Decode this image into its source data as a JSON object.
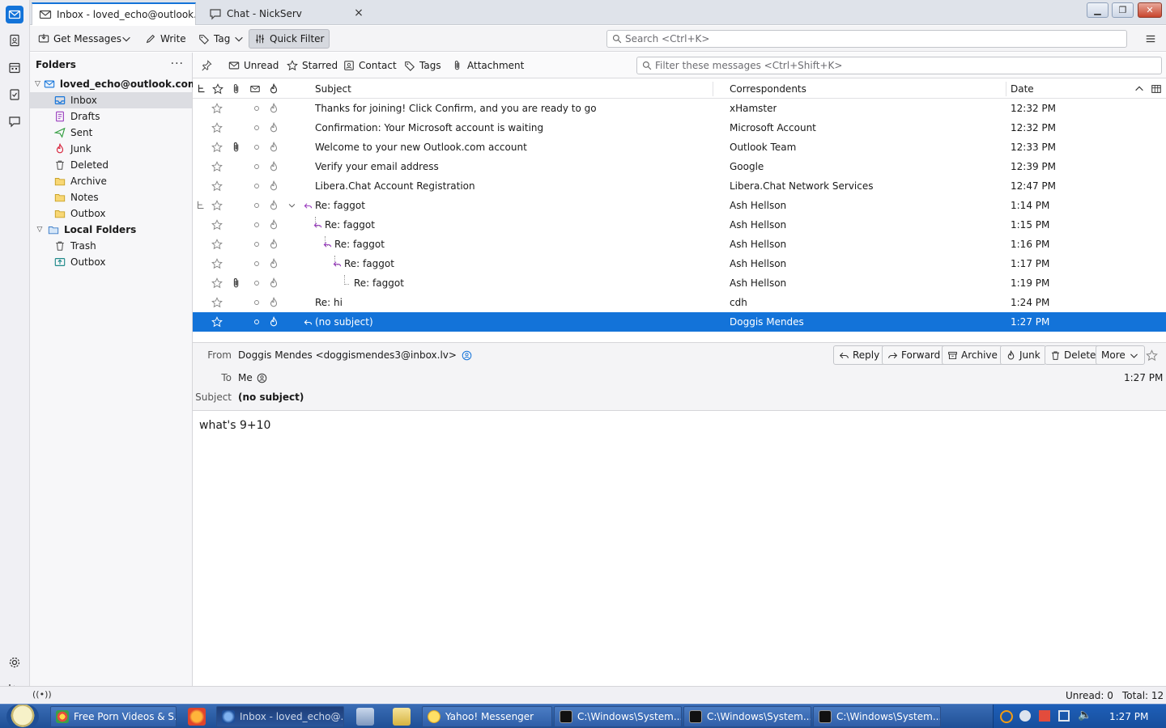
{
  "tabs": [
    {
      "label": "Inbox - loved_echo@outlook.co"
    },
    {
      "label": "Chat - NickServ"
    }
  ],
  "toolbar": {
    "get_messages": "Get Messages",
    "write": "Write",
    "tag": "Tag",
    "quick_filter": "Quick Filter",
    "search_placeholder": "Search <Ctrl+K>"
  },
  "folder_pane": {
    "title": "Folders",
    "account": "loved_echo@outlook.com",
    "folders": [
      "Inbox",
      "Drafts",
      "Sent",
      "Junk",
      "Deleted",
      "Archive",
      "Notes",
      "Outbox"
    ],
    "local_account": "Local Folders",
    "local_folders": [
      "Trash",
      "Outbox"
    ],
    "selected": "Inbox"
  },
  "quick_filter": {
    "unread": "Unread",
    "starred": "Starred",
    "contact": "Contact",
    "tags": "Tags",
    "attachment": "Attachment",
    "filter_placeholder": "Filter these messages <Ctrl+Shift+K>"
  },
  "columns": {
    "subject": "Subject",
    "correspondents": "Correspondents",
    "date": "Date"
  },
  "messages": [
    {
      "subject": "Thanks for joining! Click Confirm, and you are ready to go",
      "from": "xHamster",
      "date": "12:32 PM",
      "attachment": false,
      "depth": 0,
      "replied": false
    },
    {
      "subject": "Confirmation: Your Microsoft account is waiting",
      "from": "Microsoft Account",
      "date": "12:32 PM",
      "attachment": false,
      "depth": 0,
      "replied": false
    },
    {
      "subject": "Welcome to your new Outlook.com account",
      "from": "Outlook Team",
      "date": "12:33 PM",
      "attachment": true,
      "depth": 0,
      "replied": false
    },
    {
      "subject": "Verify your email address",
      "from": "Google",
      "date": "12:39 PM",
      "attachment": false,
      "depth": 0,
      "replied": false
    },
    {
      "subject": "Libera.Chat Account Registration",
      "from": "Libera.Chat Network Services",
      "date": "12:47 PM",
      "attachment": false,
      "depth": 0,
      "replied": false
    },
    {
      "subject": "Re: faggot",
      "from": "Ash Hellson",
      "date": "1:14 PM",
      "attachment": false,
      "depth": 0,
      "replied": true,
      "thread_root": true
    },
    {
      "subject": "Re: faggot",
      "from": "Ash Hellson",
      "date": "1:15 PM",
      "attachment": false,
      "depth": 1,
      "replied": true
    },
    {
      "subject": "Re: faggot",
      "from": "Ash Hellson",
      "date": "1:16 PM",
      "attachment": false,
      "depth": 2,
      "replied": true
    },
    {
      "subject": "Re: faggot",
      "from": "Ash Hellson",
      "date": "1:17 PM",
      "attachment": false,
      "depth": 3,
      "replied": true
    },
    {
      "subject": "Re: faggot",
      "from": "Ash Hellson",
      "date": "1:19 PM",
      "attachment": true,
      "depth": 4,
      "replied": false
    },
    {
      "subject": "Re: hi",
      "from": "cdh",
      "date": "1:24 PM",
      "attachment": false,
      "depth": 0,
      "replied": false
    },
    {
      "subject": "(no subject)",
      "from": "Doggis Mendes",
      "date": "1:27 PM",
      "attachment": false,
      "depth": 0,
      "replied": true,
      "selected": true
    }
  ],
  "message_header": {
    "from_label": "From",
    "from_value": "Doggis Mendes <doggismendes3@inbox.lv>",
    "to_label": "To",
    "to_value": "Me",
    "subject_label": "Subject",
    "subject_value": "(no subject)",
    "date": "1:27 PM",
    "actions": {
      "reply": "Reply",
      "forward": "Forward",
      "archive": "Archive",
      "junk": "Junk",
      "delete": "Delete",
      "more": "More"
    }
  },
  "message_body": "what's 9+10",
  "status": {
    "unread": "Unread: 0",
    "total": "Total: 12"
  },
  "taskbar": {
    "items": [
      "Free Porn Videos & S...",
      "Inbox - loved_echo@...",
      "Yahoo! Messenger",
      "C:\\Windows\\System...",
      "C:\\Windows\\System...",
      "C:\\Windows\\System..."
    ],
    "clock": "1:27 PM"
  },
  "colors": {
    "accent": "#1373d9",
    "taskbar": "#2a5aa3"
  }
}
